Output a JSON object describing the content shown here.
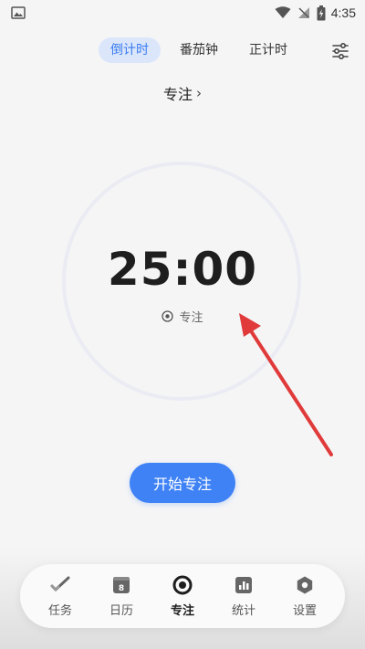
{
  "status_bar": {
    "time": "4:35"
  },
  "mode_tabs": [
    {
      "label": "倒计时",
      "active": true
    },
    {
      "label": "番茄钟",
      "active": false
    },
    {
      "label": "正计时",
      "active": false
    }
  ],
  "focus": {
    "title": "专注",
    "chevron": "›"
  },
  "timer": {
    "time": "25:00",
    "label": "专注"
  },
  "start_button": {
    "label": "开始专注"
  },
  "bottom_nav": [
    {
      "label": "任务",
      "icon": "check-icon",
      "active": false
    },
    {
      "label": "日历",
      "icon": "calendar-icon",
      "calendar_day": "8",
      "active": false
    },
    {
      "label": "专注",
      "icon": "focus-icon",
      "active": true
    },
    {
      "label": "统计",
      "icon": "stats-icon",
      "active": false
    },
    {
      "label": "设置",
      "icon": "settings-icon",
      "active": false
    }
  ],
  "colors": {
    "accent": "#3f82f5",
    "active_tab_bg": "#dbe6fb",
    "annotation_arrow": "#e03a3a"
  }
}
